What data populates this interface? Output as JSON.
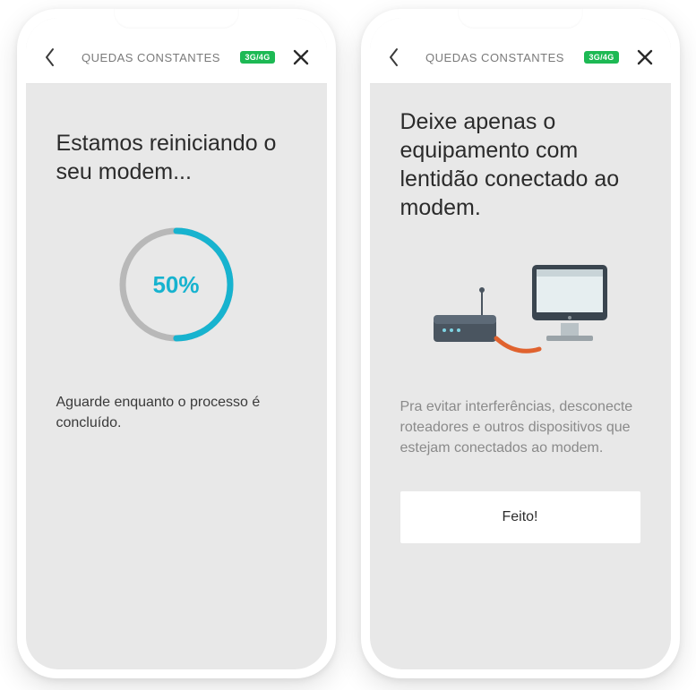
{
  "common": {
    "header_title": "QUEDAS CONSTANTES",
    "network_badge": "3G/4G"
  },
  "screen1": {
    "headline": "Estamos reiniciando o seu modem...",
    "progress_percent": 50,
    "progress_label": "50%",
    "subtext": "Aguarde enquanto o processo é concluído."
  },
  "screen2": {
    "headline": "Deixe apenas o equipamento com lentidão conectado ao modem.",
    "subtext": "Pra evitar interferências, desconecte roteadores e outros dispositivos que estejam conectados ao modem.",
    "button_label": "Feito!"
  },
  "colors": {
    "accent_cyan": "#17b3cf",
    "badge_green": "#1db954"
  }
}
